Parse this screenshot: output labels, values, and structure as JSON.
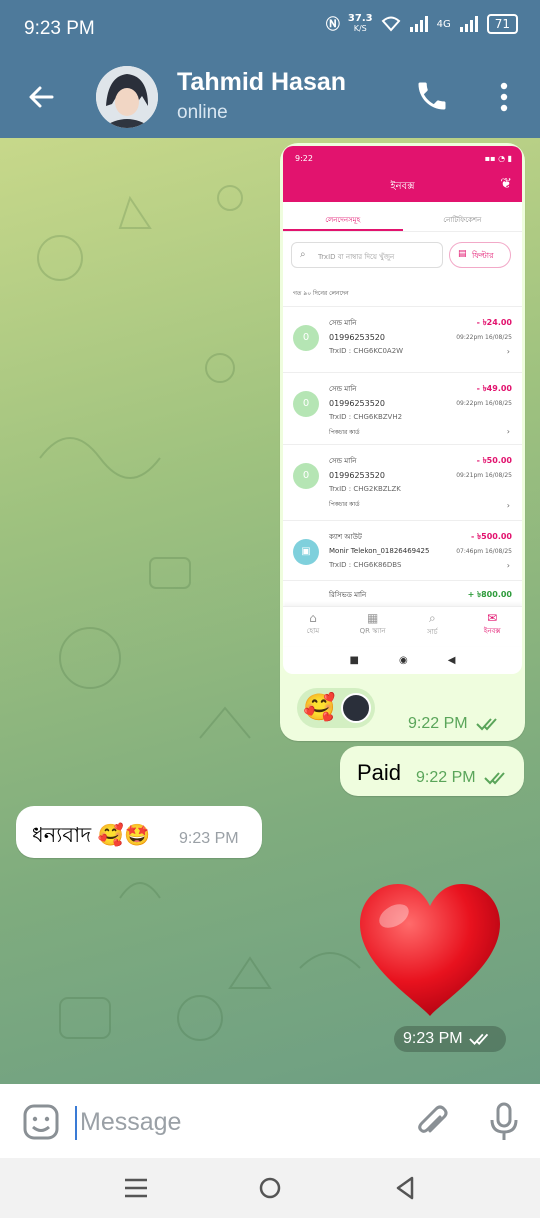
{
  "status_bar": {
    "time": "9:23 PM",
    "speed_top": "37.3",
    "speed_unit": "K/S",
    "net": "4G",
    "battery": "71"
  },
  "header": {
    "name": "Tahmid Hasan",
    "status": "online"
  },
  "screenshot": {
    "time": "9:22",
    "title": "ইনবক্স",
    "tabs": [
      "লেনদেনসমূহ",
      "নোটিফিকেশন"
    ],
    "search_placeholder": "TrxID বা নাম্বার দিয়ে খুঁজুন",
    "filter_label": "ফিল্টার",
    "section_label": "গত ৯০ দিনের লেনদেন",
    "transactions": [
      {
        "type": "সেন্ড মানি",
        "number": "01996253520",
        "trx": "TrxID : CHG6KC0A2W",
        "amount": "- ৳24.00",
        "time": "09:22pm 16/08/25",
        "card": ""
      },
      {
        "type": "সেন্ড মানি",
        "number": "01996253520",
        "trx": "TrxID : CHG6KBZVH2",
        "amount": "- ৳49.00",
        "time": "09:22pm 16/08/25",
        "card": "পিকচার কার্ড"
      },
      {
        "type": "সেন্ড মানি",
        "number": "01996253520",
        "trx": "TrxID : CHG2KBZLZK",
        "amount": "- ৳50.00",
        "time": "09:21pm 16/08/25",
        "card": "পিকচার কার্ড"
      },
      {
        "type": "ক্যাশ আউট",
        "number": "Monir Telekon_01826469425",
        "trx": "TrxID : CHG6K86DBS",
        "amount": "- ৳500.00",
        "time": "07:46pm 16/08/25",
        "card": ""
      },
      {
        "type": "রিসিভড মানি",
        "number": "",
        "trx": "",
        "amount": "+ ৳800.00",
        "time": "",
        "card": ""
      }
    ],
    "nav": [
      "হোম",
      "QR স্ক্যান",
      "সার্চ",
      "ইনবক্স"
    ]
  },
  "messages": {
    "screenshot_time": "9:22 PM",
    "paid_text": "Paid",
    "paid_time": "9:22 PM",
    "incoming_text": "ধন্যবাদ 🥰🤩",
    "incoming_time": "9:23 PM",
    "heart_time": "9:23 PM"
  },
  "input": {
    "placeholder": "Message"
  },
  "colors": {
    "header": "#4e7a9b",
    "bkash": "#e2136e",
    "outgoing": "#effdde",
    "check": "#5aa55a"
  }
}
